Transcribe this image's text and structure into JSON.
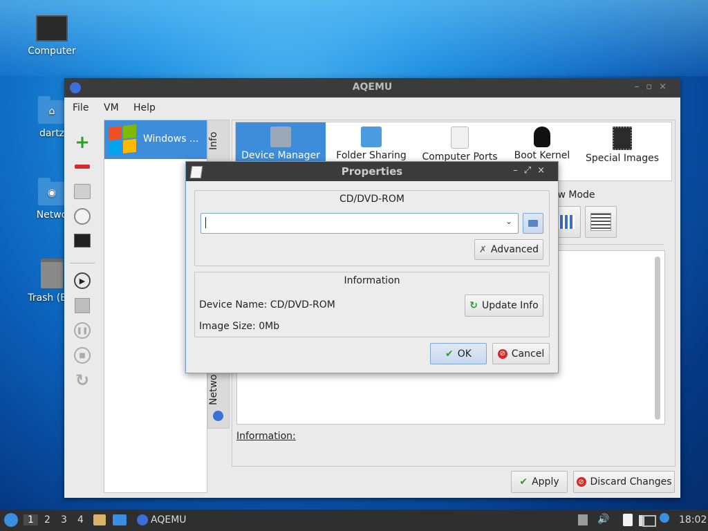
{
  "desktop": {
    "icons": [
      {
        "label": "Computer",
        "icon": "computer-icon"
      },
      {
        "label": "dartz",
        "icon": "home-folder-icon"
      },
      {
        "label": "Netwo",
        "icon": "network-folder-icon"
      },
      {
        "label": "Trash (Em",
        "icon": "trash-icon"
      }
    ]
  },
  "window": {
    "title": "AQEMU",
    "menu": [
      "File",
      "VM",
      "Help"
    ],
    "vm_list": [
      {
        "name": "Windows ..."
      }
    ],
    "side_tabs": {
      "info": "Info",
      "network": "Netwo"
    },
    "categories": [
      "Device Manager",
      "Folder Sharing",
      "Computer Ports",
      "Boot Kernel",
      "Special Images"
    ],
    "view_mode_label": "iew Mode",
    "information_label": "Information:",
    "apply_label": "Apply",
    "discard_label": "Discard Changes"
  },
  "dialog": {
    "title": "Properties",
    "group1_title": "CD/DVD-ROM",
    "combo_value": "",
    "advanced_label": "Advanced",
    "group2_title": "Information",
    "device_name": "Device Name: CD/DVD-ROM",
    "image_size": "Image Size: 0Mb",
    "update_info_label": "Update Info",
    "ok_label": "OK",
    "cancel_label": "Cancel"
  },
  "taskbar": {
    "workspaces": [
      "1",
      "2",
      "3",
      "4"
    ],
    "active_workspace": "1",
    "task_label": "AQEMU",
    "clock": "18:02"
  },
  "colors": {
    "accent": "#3e8ddb",
    "titlebar": "#3b3b3b",
    "taskbar": "#2f2f2f"
  }
}
